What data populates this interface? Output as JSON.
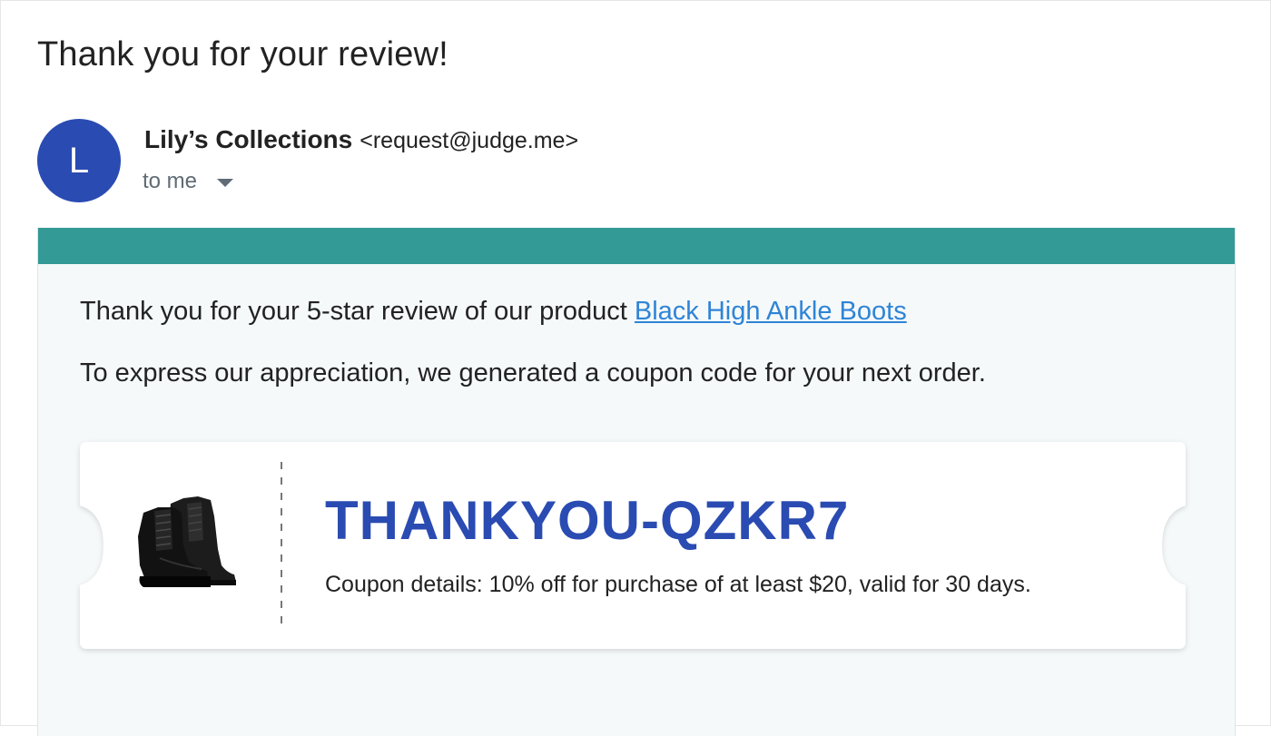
{
  "email": {
    "subject": "Thank you for your review!",
    "avatar_letter": "L",
    "sender_name": "Lily’s Collections",
    "sender_email": "<request@judge.me>",
    "recipient_label": "to me"
  },
  "body": {
    "line1_prefix": "Thank you for your 5-star review of our product ",
    "product_link": "Black High Ankle Boots",
    "line2": "To express our appreciation, we generated a coupon code for your next order."
  },
  "coupon": {
    "code": "THANKYOU-QZKR7",
    "details": "Coupon details: 10% off for purchase of at least $20, valid for 30 days.",
    "image_name": "black-ankle-boots-image"
  },
  "colors": {
    "accent_teal": "#339a96",
    "avatar_blue": "#2a4bb2",
    "coupon_code_blue": "#2a4bb2",
    "link_blue": "#2f84d6",
    "body_background": "#f5f9fa"
  },
  "icons": {
    "recipient_caret": "caret-down-icon"
  }
}
